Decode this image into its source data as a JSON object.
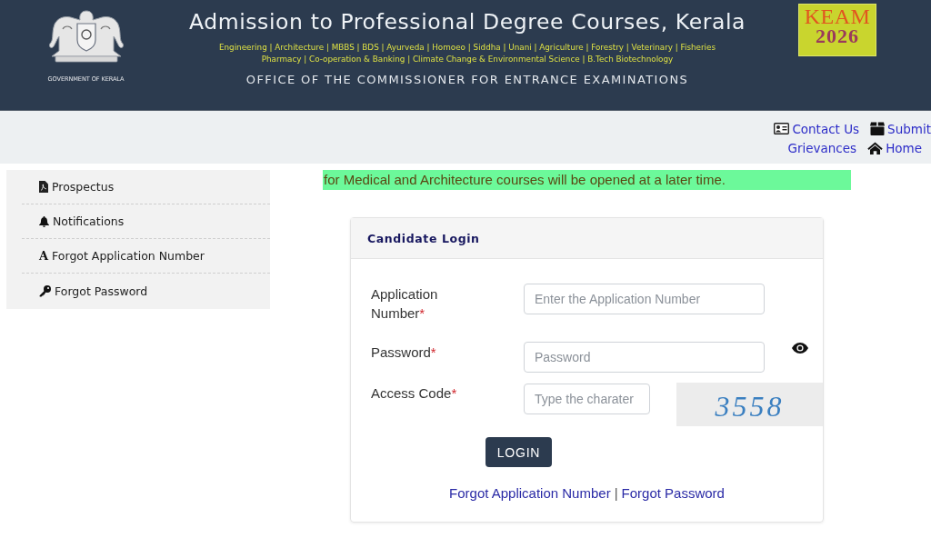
{
  "header": {
    "emblem_caption": "GOVERNMENT OF KERALA",
    "title": "Admission to Professional Degree Courses, Kerala",
    "course_lines": [
      "Engineering | Architecture | MBBS | BDS | Ayurveda | Homoeo | Siddha | Unani | Agriculture | Forestry | Veterinary | Fisheries",
      "Pharmacy | Co-operation & Banking | Climate Change & Environmental Science | B.Tech Biotechnology"
    ],
    "subtitle": "OFFICE OF THE COMMISSIONER FOR ENTRANCE EXAMINATIONS",
    "badge": {
      "title": "KEAM",
      "year": "2026"
    }
  },
  "top_links": [
    {
      "items": [
        {
          "kind": "contact",
          "label": "Contact Us"
        },
        {
          "kind": "submit",
          "label": "Submit"
        }
      ]
    },
    {
      "items": [
        {
          "kind": "plain",
          "label": "Grievances"
        },
        {
          "kind": "home",
          "label": "Home"
        }
      ]
    }
  ],
  "sidebar": {
    "items": [
      {
        "kind": "document",
        "label": "Prospectus"
      },
      {
        "kind": "alert",
        "label": "Notifications"
      },
      {
        "kind": "letter",
        "icon_text": "A",
        "label": "Forgot Application Number"
      },
      {
        "kind": "password",
        "label": "Forgot Password"
      }
    ]
  },
  "notice": "for Medical and Architecture courses will be opened at a later time.",
  "login": {
    "title": "Candidate Login",
    "fields": [
      {
        "kind": "text",
        "label": "Application Number",
        "required_mark": "*",
        "placeholder": "Enter the Application Number"
      },
      {
        "kind": "password",
        "label": "Password",
        "required_mark": "*",
        "placeholder": "Password"
      },
      {
        "kind": "captcha",
        "label": "Access Code",
        "required_mark": "*",
        "placeholder": "Type the charater",
        "captcha_text": "3558"
      }
    ],
    "button": "LOGIN",
    "links": [
      {
        "label": "Forgot Application Number"
      },
      {
        "label": "Forgot Password"
      }
    ],
    "link_separator": "|"
  }
}
